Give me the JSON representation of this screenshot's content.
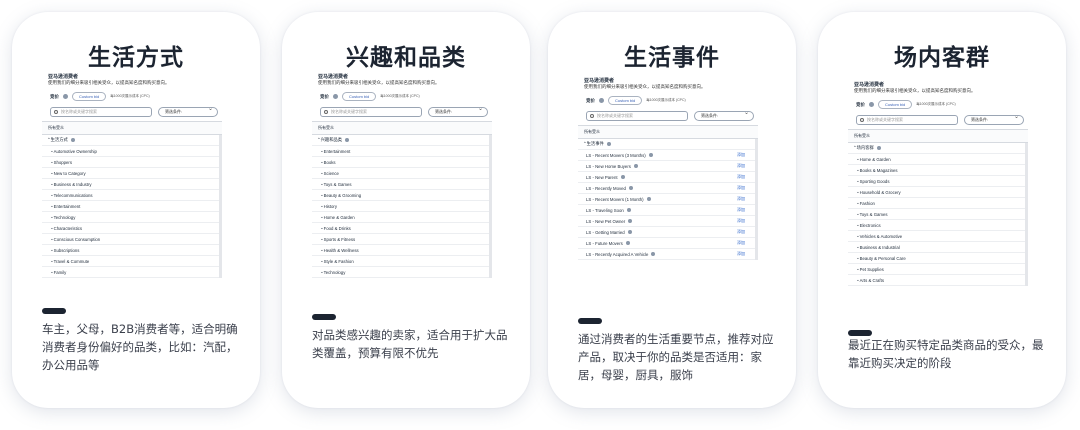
{
  "cards": [
    {
      "title": "生活方式",
      "shot": {
        "heading": "亚马逊消费者",
        "subheading": "使用我们的细分来吸引相关受众，以提高知名度和购买意向。",
        "bid_label": "竞价",
        "bid_value": "Custom bid",
        "bid_note": "每1000次展示成本 (CPC)",
        "search_placeholder": "按名称或关键字搜索",
        "filter_label": "筛选条件:",
        "section_label": "所有受众",
        "parent": "生活方式",
        "items": [
          "Automotive Ownership",
          "Shoppers",
          "New to Category",
          "Business & Industry",
          "Telecommunications",
          "Entertainment",
          "Technology",
          "Characteristics",
          "Conscious Consumption",
          "Subscriptions",
          "Travel & Commute",
          "Family"
        ]
      },
      "description": "车主，父母，B2B消费者等，适合明确消费者身份偏好的品类，比如：汽配，办公用品等"
    },
    {
      "title": "兴趣和品类",
      "shot": {
        "heading": "亚马逊消费者",
        "subheading": "使用我们的细分来吸引相关受众，以提高知名度和购买意向。",
        "bid_label": "竞价",
        "bid_value": "Custom bid",
        "bid_note": "每1000次展示成本 (CPC)",
        "search_placeholder": "按名称或关键字搜索",
        "filter_label": "筛选条件:",
        "section_label": "所有受众",
        "parent": "兴趣和品类",
        "items": [
          "Entertainment",
          "Books",
          "Science",
          "Toys & Games",
          "Beauty & Grooming",
          "History",
          "Home & Garden",
          "Food & Drinks",
          "Sports & Fitness",
          "Health & Wellness",
          "Style & Fashion",
          "Technology"
        ]
      },
      "description": "对品类感兴趣的卖家，适合用于扩大品类覆盖，预算有限不优先"
    },
    {
      "title": "生活事件",
      "shot": {
        "heading": "亚马逊消费者",
        "subheading": "使用我们的细分来吸引相关受众，以提高知名度和购买意向。",
        "bid_label": "竞价",
        "bid_value": "Custom bid",
        "bid_note": "每1000次展示成本 (CPC)",
        "search_placeholder": "按名称或关键字搜索",
        "filter_label": "筛选条件:",
        "section_label": "所有受众",
        "parent": "生活事件",
        "add_label": "添加",
        "items": [
          "LS - Recent Movers (3 Months)",
          "LS - New Home Buyers",
          "LS - New Parent",
          "LS - Recently Moved",
          "LS - Recent Movers (1 Month)",
          "LS - Traveling Soon",
          "LS - New Pet Owner",
          "LS - Getting Married",
          "LS - Future Movers",
          "LS - Recently Acquired A Vehicle"
        ]
      },
      "description": "通过消费者的生活重要节点，推荐对应产品，取决于你的品类是否适用：家居，母婴，厨具，服饰"
    },
    {
      "title": "场内客群",
      "shot": {
        "heading": "亚马逊消费者",
        "subheading": "使用我们的细分来吸引相关受众，以提高知名度和购买意向。",
        "bid_label": "竞价",
        "bid_value": "Custom bid",
        "bid_note": "每1000次展示成本 (CPC)",
        "search_placeholder": "按名称或关键字搜索",
        "filter_label": "筛选条件:",
        "section_label": "所有受众",
        "parent": "场内客群",
        "items": [
          "Home & Garden",
          "Books & Magazines",
          "Sporting Goods",
          "Household & Grocery",
          "Fashion",
          "Toys & Games",
          "Electronics",
          "Vehicles & Automotive",
          "Business & Industrial",
          "Beauty & Personal Care",
          "Pet Supplies",
          "Arts & Crafts"
        ]
      },
      "description": "最近正在购买特定品类商品的受众，最靠近购买决定的阶段"
    }
  ],
  "colors": {
    "title": "#1c2431",
    "link": "#2761c9",
    "text": "#3a3f4b"
  }
}
